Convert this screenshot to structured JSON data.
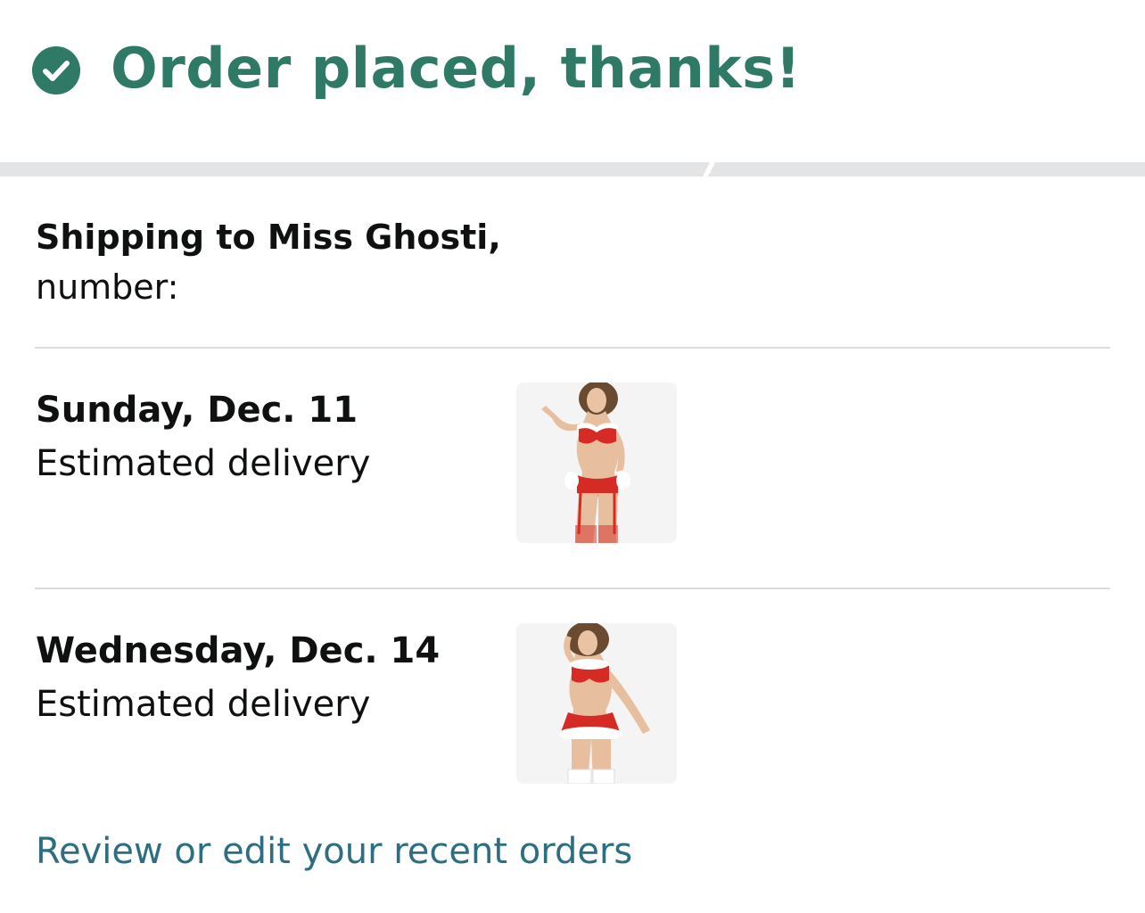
{
  "header": {
    "title": "Order placed, thanks!",
    "icon": "check-circle-icon",
    "accent_color": "#2f7a66"
  },
  "shipping": {
    "line1": "Shipping to Miss Ghosti,",
    "line2": "number:"
  },
  "deliveries": [
    {
      "date": "Sunday, Dec. 11",
      "label": "Estimated delivery",
      "product_image": "red-lingerie-set-with-garters-image"
    },
    {
      "date": "Wednesday, Dec. 14",
      "label": "Estimated delivery",
      "product_image": "red-lingerie-set-with-fur-trim-image"
    }
  ],
  "links": {
    "review_orders": "Review or edit your recent orders",
    "link_color": "#2d6e82"
  }
}
